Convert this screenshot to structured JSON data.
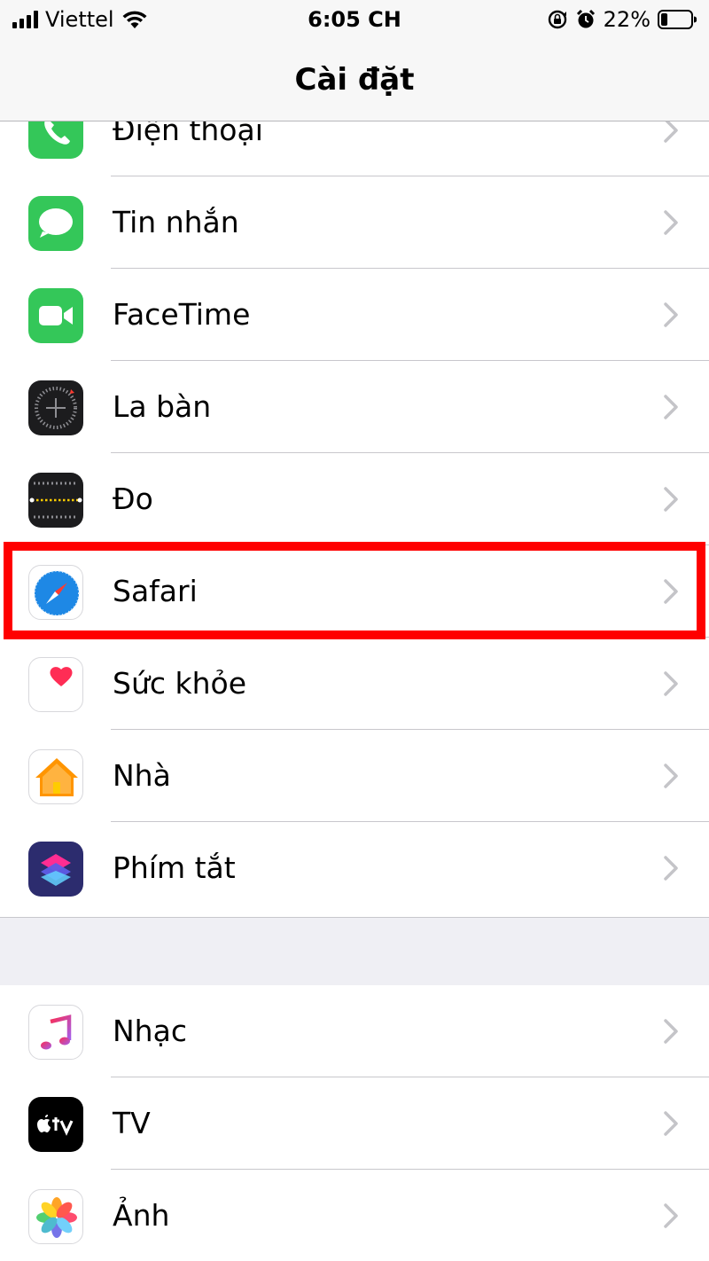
{
  "status_bar": {
    "carrier": "Viettel",
    "time": "6:05 CH",
    "battery_percent": "22%",
    "battery_level": 0.22,
    "icons": [
      "signal-icon",
      "wifi-icon",
      "rotation-lock-icon",
      "alarm-icon",
      "battery-icon"
    ]
  },
  "nav": {
    "title": "Cài đặt"
  },
  "groups": [
    {
      "items": [
        {
          "label": "Điện thoại",
          "icon": "phone-icon",
          "color": "#34c759"
        },
        {
          "label": "Tin nhắn",
          "icon": "messages-icon",
          "color": "#34c759"
        },
        {
          "label": "FaceTime",
          "icon": "facetime-icon",
          "color": "#34c759"
        },
        {
          "label": "La bàn",
          "icon": "compass-icon",
          "color": "#1c1c1e"
        },
        {
          "label": "Đo",
          "icon": "measure-icon",
          "color": "#1c1c1e"
        },
        {
          "label": "Safari",
          "icon": "safari-icon",
          "color": "#1e88e5",
          "highlighted": true
        },
        {
          "label": "Sức khỏe",
          "icon": "health-icon",
          "color": "#ff2d55"
        },
        {
          "label": "Nhà",
          "icon": "home-icon",
          "color": "#ff9500"
        },
        {
          "label": "Phím tắt",
          "icon": "shortcuts-icon",
          "color": "#3a3a8c"
        }
      ]
    },
    {
      "items": [
        {
          "label": "Nhạc",
          "icon": "music-icon",
          "color": "#fa2d55"
        },
        {
          "label": "TV",
          "icon": "tv-icon",
          "color": "#000000"
        },
        {
          "label": "Ảnh",
          "icon": "photos-icon",
          "color": "#ffcc00"
        }
      ]
    }
  ],
  "colors": {
    "highlight": "#ff0000",
    "separator": "#c8c7cc",
    "chevron": "#c4c4c8",
    "background": "#efeff4"
  }
}
